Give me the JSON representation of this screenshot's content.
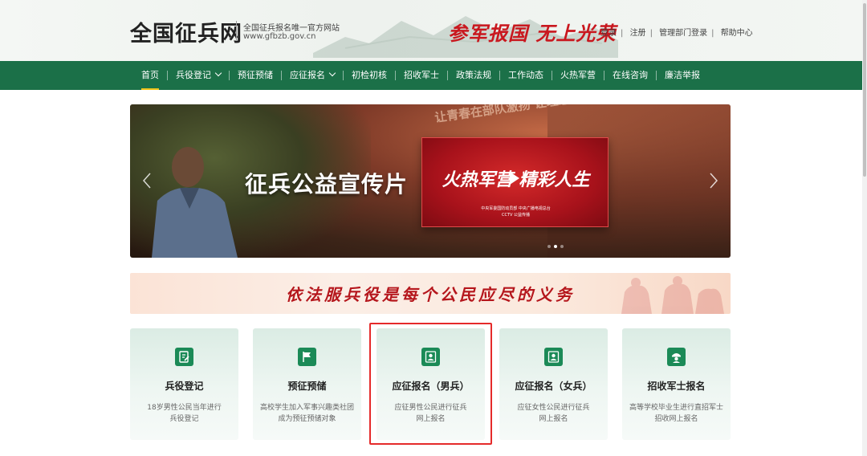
{
  "header": {
    "site_title": "全国征兵网",
    "subtitle": "全国征兵报名唯一官方网站",
    "domain": "www.gfbzb.gov.cn",
    "slogan": "参军报国  无上光荣",
    "links": [
      "登录",
      "注册",
      "管理部门登录",
      "帮助中心"
    ]
  },
  "nav": {
    "items": [
      {
        "label": "首页",
        "active": true,
        "dropdown": false
      },
      {
        "label": "兵役登记",
        "active": false,
        "dropdown": true
      },
      {
        "label": "预征预储",
        "active": false,
        "dropdown": false
      },
      {
        "label": "应征报名",
        "active": false,
        "dropdown": true
      },
      {
        "label": "初检初核",
        "active": false,
        "dropdown": false
      },
      {
        "label": "招收军士",
        "active": false,
        "dropdown": false
      },
      {
        "label": "政策法规",
        "active": false,
        "dropdown": false
      },
      {
        "label": "工作动态",
        "active": false,
        "dropdown": false
      },
      {
        "label": "火热军营",
        "active": false,
        "dropdown": false
      },
      {
        "label": "在线咨询",
        "active": false,
        "dropdown": false
      },
      {
        "label": "廉洁举报",
        "active": false,
        "dropdown": false
      }
    ]
  },
  "banner": {
    "background_text": "让青春在部队激扬  让理想在军营放飞",
    "title": "征兵公益宣传片",
    "card_title": "火热军营 精彩人生",
    "card_sub1": "中央军委国防动员部  中央广播电视总台",
    "card_sub2": "CCTV   公益传播",
    "slide_count": 3,
    "active_slide": 1
  },
  "motto": {
    "text": "依法服兵役是每个公民应尽的义务"
  },
  "cards": [
    {
      "title": "兵役登记",
      "desc1": "18岁男性公民当年进行",
      "desc2": "兵役登记",
      "icon": "edit-document-icon"
    },
    {
      "title": "预征预储",
      "desc1": "高校学生加入军事兴趣类社团",
      "desc2": "成为预征预储对象",
      "icon": "flag-icon"
    },
    {
      "title": "应征报名（男兵）",
      "desc1": "应征男性公民进行征兵",
      "desc2": "网上报名",
      "icon": "person-badge-icon"
    },
    {
      "title": "应征报名（女兵）",
      "desc1": "应征女性公民进行征兵",
      "desc2": "网上报名",
      "icon": "person-badge-icon"
    },
    {
      "title": "招收军士报名",
      "desc1": "高等学校毕业生进行直招军士",
      "desc2": "招收网上报名",
      "icon": "soldier-icon"
    }
  ],
  "colors": {
    "nav_green": "#1b7048",
    "accent_red": "#c9171e",
    "icon_green": "#1b8a57",
    "active_underline": "#f0c419",
    "highlight_border": "#e52a2a"
  }
}
